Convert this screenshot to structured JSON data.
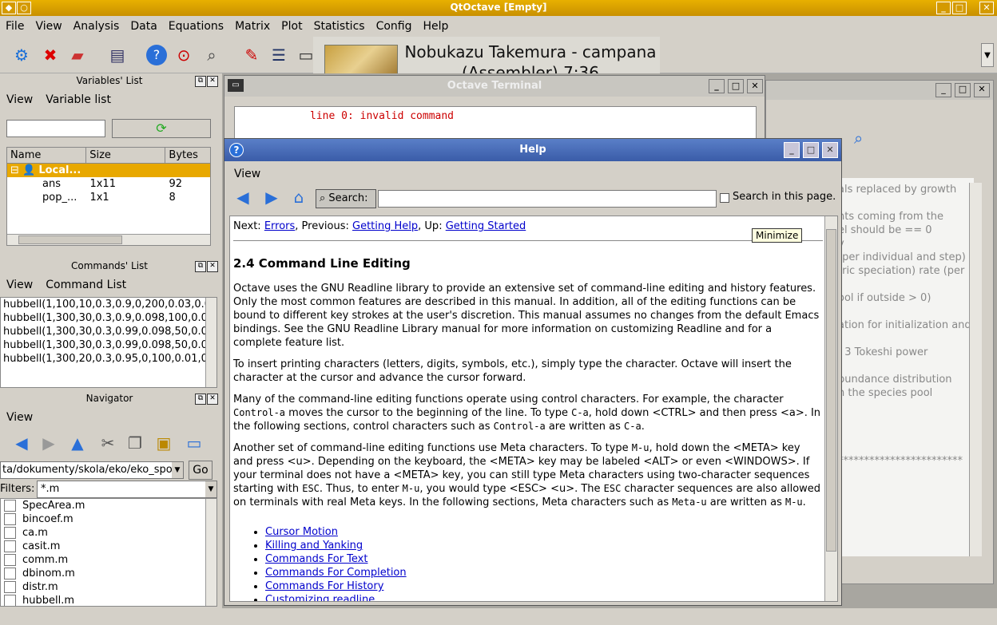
{
  "window": {
    "title": "QtOctave [Empty]"
  },
  "menu": [
    "File",
    "View",
    "Analysis",
    "Data",
    "Equations",
    "Matrix",
    "Plot",
    "Statistics",
    "Config",
    "Help"
  ],
  "notification": {
    "text": "Nobukazu Takemura - campana (Assembler) 7:36"
  },
  "variables_panel": {
    "title": "Variables' List",
    "menu": [
      "View",
      "Variable list"
    ],
    "columns": [
      "Name",
      "Size",
      "Bytes"
    ],
    "group": "Local...",
    "rows": [
      {
        "name": "ans",
        "size": "1x11",
        "bytes": "92"
      },
      {
        "name": "pop_...",
        "size": "1x1",
        "bytes": "8"
      }
    ]
  },
  "commands_panel": {
    "title": "Commands' List",
    "menu": [
      "View",
      "Command List"
    ],
    "items": [
      "hubbell(1,100,10,0.3,0.9,0,200,0.03,0.0",
      "hubbell(1,300,30,0.3,0.9,0.098,100,0.03",
      "hubbell(1,300,30,0.3,0.99,0.098,50,0.03",
      "hubbell(1,300,30,0.3,0.99,0.098,50,0.03",
      "hubbell(1,300,20,0.3,0.95,0,100,0.01,0."
    ]
  },
  "navigator_panel": {
    "title": "Navigator",
    "menu": [
      "View"
    ],
    "path": "ta/dokumenty/skola/eko/eko_spol",
    "go_label": "Go",
    "filters_label": "Filters:",
    "filter_value": "*.m",
    "files": [
      "SpecArea.m",
      "bincoef.m",
      "ca.m",
      "casit.m",
      "comm.m",
      "dbinom.m",
      "distr.m",
      "hubbell.m"
    ]
  },
  "terminal": {
    "title": "Octave Terminal",
    "line": "line 0: invalid command"
  },
  "background_editor": {
    "lines": [
      "als replaced by growth",
      "nts coming from the",
      "el should be == 0",
      "y",
      "(per individual and step)",
      "tric speciation) rate (per",
      "ool if outside > 0)",
      "ation for initialization and",
      ", 3 Tokeshi power",
      "bundance distribution",
      "n the species pool",
      "************************"
    ]
  },
  "help": {
    "title": "Help",
    "menu": [
      "View"
    ],
    "search_label": "Search:",
    "search_in_page": "Search in this page.",
    "tooltip": "Minimize",
    "nav": {
      "next_label": "Next:",
      "next": "Errors",
      "prev_label": ", Previous:",
      "prev": "Getting Help",
      "up_label": ", Up:",
      "up": "Getting Started"
    },
    "heading": "2.4 Command Line Editing",
    "paragraphs": [
      "Octave uses the GNU Readline library to provide an extensive set of command-line editing and history features. Only the most common features are described in this manual. In addition, all of the editing functions can be bound to different key strokes at the user's discretion. This manual assumes no changes from the default Emacs bindings. See the GNU Readline Library manual for more information on customizing Readline and for a complete feature list.",
      "To insert printing characters (letters, digits, symbols, etc.), simply type the character. Octave will insert the character at the cursor and advance the cursor forward."
    ],
    "p3": {
      "a": "Many of the command-line editing functions operate using control characters. For example, the character ",
      "b": "Control-a",
      "c": " moves the cursor to the beginning of the line. To type ",
      "d": "C-a",
      "e": ", hold down <CTRL> and then press <a>. In the following sections, control characters such as ",
      "f": "Control-a",
      "g": " are written as ",
      "h": "C-a",
      "i": "."
    },
    "p4": {
      "a": "Another set of command-line editing functions use Meta characters. To type ",
      "b": "M-u",
      "c": ", hold down the <META> key and press <u>. Depending on the keyboard, the <META> key may be labeled <ALT> or even <WINDOWS>. If your terminal does not have a <META> key, you can still type Meta characters using two-character sequences starting with ",
      "d": "ESC",
      "e": ". Thus, to enter ",
      "f": "M-u",
      "g": ", you would type <ESC> <u>. The ",
      "h": "ESC",
      "i": " character sequences are also allowed on terminals with real Meta keys. In the following sections, Meta characters such as ",
      "j": "Meta-u",
      "k": " are written as ",
      "l": "M-u",
      "m": "."
    },
    "links": [
      "Cursor Motion",
      "Killing and Yanking",
      "Commands For Text",
      "Commands For Completion",
      "Commands For History",
      "Customizing readline"
    ]
  }
}
